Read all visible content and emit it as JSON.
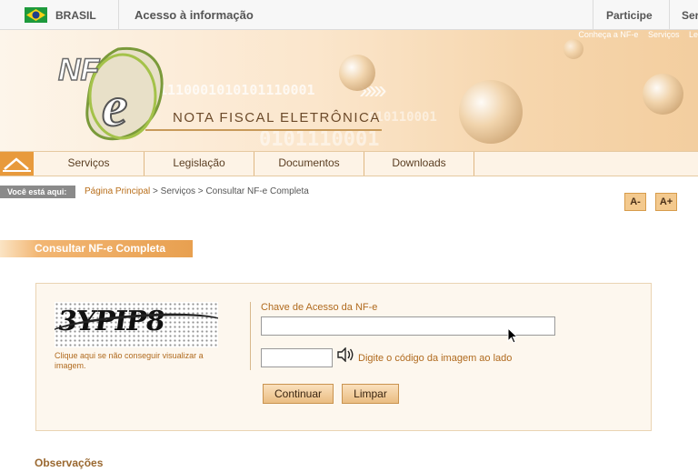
{
  "govbar": {
    "country": "BRASIL",
    "acesso": "Acesso à informação",
    "participe": "Participe",
    "servicos_cut": "Ser"
  },
  "banner": {
    "toplinks": [
      "Conheça a NF-e",
      "Serviços",
      "Le"
    ],
    "logo_nf": "NF",
    "logo_e": "e",
    "title": "NOTA FISCAL ELETRÔNICA",
    "binary_1": "1110001010101110001",
    "binary_2": "0101110001",
    "binary_3": "010110001"
  },
  "nav": {
    "items": [
      "Serviços",
      "Legislação",
      "Documentos",
      "Downloads"
    ]
  },
  "breadcrumb": {
    "label": "Você está aqui:",
    "home": "Página Principal",
    "sep1": " > ",
    "servicos": "Serviços",
    "sep2": " > ",
    "current": "Consultar NF-e Completa"
  },
  "font_controls": {
    "decrease": "A-",
    "increase": "A+"
  },
  "section_title": "Consultar NF-e Completa",
  "form": {
    "captcha_text": "3YPIP8",
    "captcha_help": "Clique aqui se não conseguir visualizar a imagem.",
    "chave_label": "Chave de Acesso da NF-e",
    "chave_value": "",
    "code_value": "",
    "code_label": "Digite o código da imagem ao lado",
    "continuar": "Continuar",
    "limpar": "Limpar"
  },
  "observacoes": "Observações",
  "colors": {
    "accent": "#e89a3c",
    "link": "#b06a1e"
  }
}
